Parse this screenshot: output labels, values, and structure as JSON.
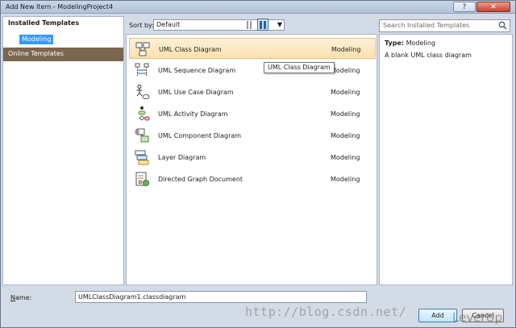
{
  "window": {
    "title": "Add New Item - ModelingProject4"
  },
  "left_panel": {
    "header": "Installed Templates",
    "selected_item": "Modeling",
    "online": "Online Templates"
  },
  "toolbar": {
    "sort_label": "Sort by:",
    "sort_value": "Default"
  },
  "search": {
    "placeholder": "Search Installed Templates"
  },
  "templates": [
    {
      "name": "UML Class Diagram",
      "category": "Modeling",
      "icon": "class-diagram-icon"
    },
    {
      "name": "UML Sequence Diagram",
      "category": "Modeling",
      "icon": "sequence-diagram-icon"
    },
    {
      "name": "UML Use Case Diagram",
      "category": "Modeling",
      "icon": "use-case-diagram-icon"
    },
    {
      "name": "UML Activity Diagram",
      "category": "Modeling",
      "icon": "activity-diagram-icon"
    },
    {
      "name": "UML Component Diagram",
      "category": "Modeling",
      "icon": "component-diagram-icon"
    },
    {
      "name": "Layer Diagram",
      "category": "Modeling",
      "icon": "layer-diagram-icon"
    },
    {
      "name": "Directed Graph Document",
      "category": "Modeling",
      "icon": "directed-graph-icon"
    }
  ],
  "tooltip": "UML Class Diagram",
  "details": {
    "type_label": "Type:",
    "type_value": "Modeling",
    "description": "A blank UML class diagram"
  },
  "name_field": {
    "label_accel": "N",
    "label_rest": "ame:",
    "value": "UMLClassDiagram1.classdiagram"
  },
  "buttons": {
    "add": "Add",
    "cancel": "Cancel"
  },
  "watermark": "http://blog.csdn.net/",
  "brandmark": "LeverUp"
}
